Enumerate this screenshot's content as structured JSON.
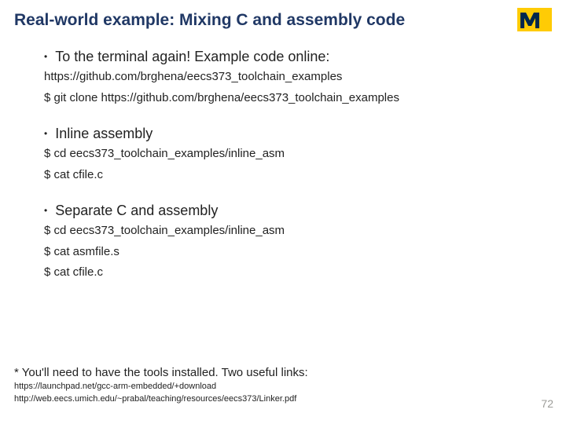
{
  "title": "Real-world example: Mixing C and assembly code",
  "bullets": [
    {
      "text": "To the terminal again!  Example code online:",
      "subs": [
        "https://github.com/brghena/eecs373_toolchain_examples",
        "$ git clone https://github.com/brghena/eecs373_toolchain_examples"
      ]
    },
    {
      "text": "Inline assembly",
      "subs": [
        "$ cd eecs373_toolchain_examples/inline_asm",
        "$ cat cfile.c"
      ]
    },
    {
      "text": "Separate C and assembly",
      "subs": [
        "$ cd eecs373_toolchain_examples/inline_asm",
        "$ cat asmfile.s",
        "$ cat cfile.c"
      ]
    }
  ],
  "footnote": "* You'll need to have the tools installed.  Two useful links:",
  "footlinks": [
    "https://launchpad.net/gcc-arm-embedded/+download",
    "http://web.eecs.umich.edu/~prabal/teaching/resources/eecs373/Linker.pdf"
  ],
  "pagenum": "72"
}
